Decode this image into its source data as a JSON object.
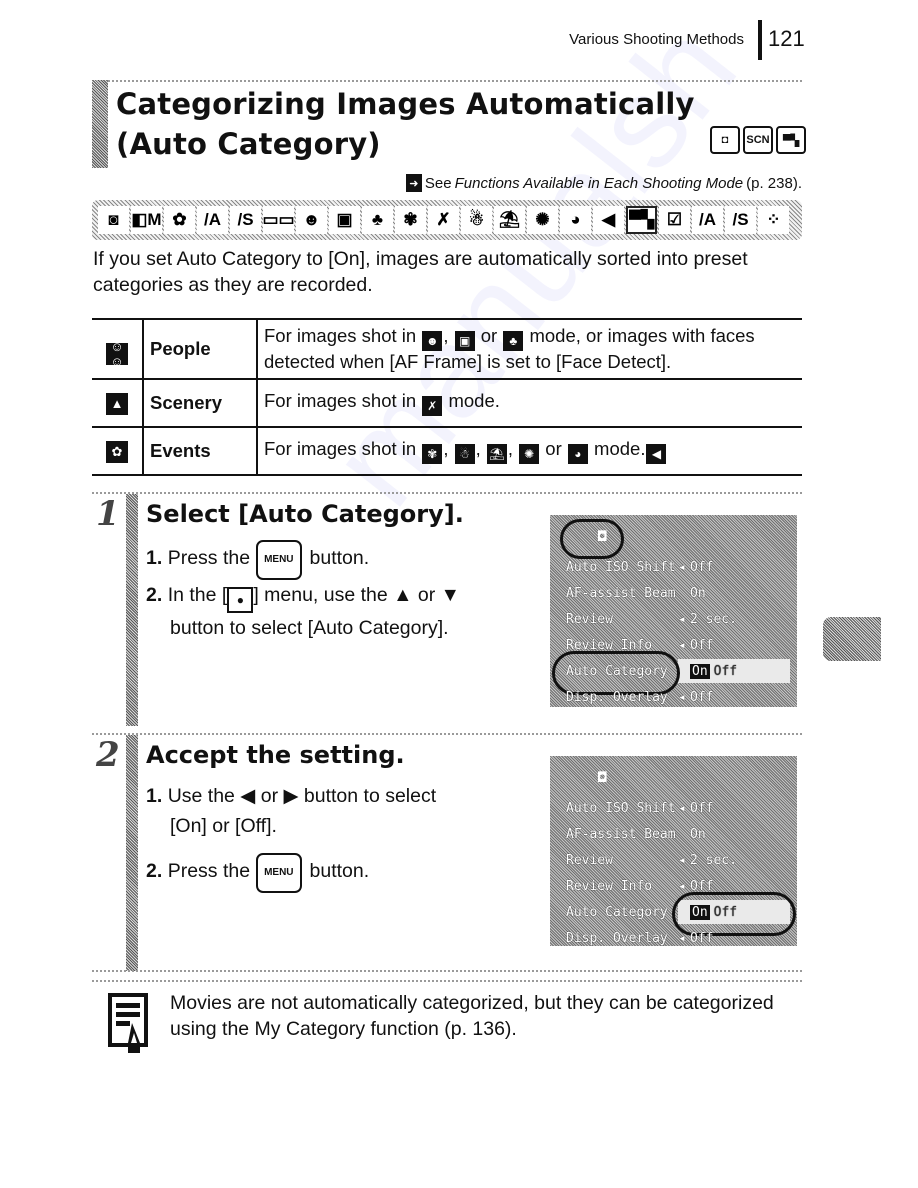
{
  "header": {
    "running_head": "Various Shooting Methods",
    "page_number": "121"
  },
  "title": {
    "line1": "Categorizing Images Automatically",
    "line2": "(Auto Category)",
    "mode_icons": [
      "camera-mode-icon",
      "scn-mode-icon",
      "movie-mode-icon"
    ],
    "mode_labels": [
      "◘",
      "SCN",
      "▀▚"
    ]
  },
  "see_also": {
    "prefix": "See",
    "italic": "Functions Available in Each Shooting Mode",
    "suffix": "(p. 238)."
  },
  "icon_strip": {
    "icons": [
      {
        "name": "auto-mode-icon",
        "glyph": "◙"
      },
      {
        "name": "camera-m-mode-icon",
        "glyph": "◧M"
      },
      {
        "name": "digital-macro-icon",
        "glyph": "✿"
      },
      {
        "name": "av-mode-icon",
        "glyph": "/A"
      },
      {
        "name": "tv-mode-icon",
        "glyph": "/S"
      },
      {
        "name": "stitch-assist-icon",
        "glyph": "▭▭"
      },
      {
        "name": "portrait-icon",
        "glyph": "☻"
      },
      {
        "name": "night-snapshot-icon",
        "glyph": "▣"
      },
      {
        "name": "kids-pets-icon",
        "glyph": "♣"
      },
      {
        "name": "indoor-party-icon",
        "glyph": "✾"
      },
      {
        "name": "foliage-icon",
        "glyph": "✗"
      },
      {
        "name": "snow-icon",
        "glyph": "☃"
      },
      {
        "name": "beach-icon",
        "glyph": "⛱"
      },
      {
        "name": "fireworks-icon",
        "glyph": "✺"
      },
      {
        "name": "aquarium-icon",
        "glyph": "◕"
      },
      {
        "name": "underwater-icon",
        "glyph": "◀"
      },
      {
        "name": "movie-standard-icon",
        "glyph": "▀▚",
        "framed": true
      },
      {
        "name": "movie-my-colors-icon",
        "glyph": "☑"
      },
      {
        "name": "movie-av-icon",
        "glyph": "/A"
      },
      {
        "name": "movie-tv-icon",
        "glyph": "/S"
      },
      {
        "name": "movie-time-lapse-icon",
        "glyph": "⁘"
      }
    ]
  },
  "intro": "If you set Auto Category to [On], images are automatically sorted into preset categories as they are recorded.",
  "table": {
    "rows": [
      {
        "icon": "people-category-icon",
        "glyph": "☺☺",
        "name": "People",
        "desc_parts": [
          "For images shot in",
          ", ",
          " or ",
          " mode, or images with faces detected when [AF Frame] is set to [Face Detect]."
        ],
        "modes": [
          {
            "name": "portrait-mode-icon",
            "glyph": "☻"
          },
          {
            "name": "night-snapshot-mode-icon",
            "glyph": "▣"
          },
          {
            "name": "kids-pets-mode-icon",
            "glyph": "♣"
          }
        ]
      },
      {
        "icon": "scenery-category-icon",
        "glyph": "▲",
        "name": "Scenery",
        "desc_parts": [
          "For images shot in",
          " mode."
        ],
        "modes": [
          {
            "name": "foliage-mode-icon",
            "glyph": "✗"
          }
        ]
      },
      {
        "icon": "events-category-icon",
        "glyph": "✿",
        "name": "Events",
        "desc_parts": [
          "For images shot in",
          ", ",
          ", ",
          ", ",
          " or ",
          " mode."
        ],
        "modes": [
          {
            "name": "indoor-party-mode-icon",
            "glyph": "✾"
          },
          {
            "name": "snow-mode-icon",
            "glyph": "☃"
          },
          {
            "name": "beach-mode-icon",
            "glyph": "⛱"
          },
          {
            "name": "fireworks-mode-icon",
            "glyph": "✺"
          },
          {
            "name": "aquarium-mode-icon",
            "glyph": "◕"
          },
          {
            "name": "underwater-mode-icon",
            "glyph": "◀"
          }
        ]
      }
    ]
  },
  "steps": [
    {
      "number": "1",
      "title": "Select [Auto Category].",
      "lines": [
        {
          "num": "1.",
          "before": "Press the",
          "button": "MENU",
          "after": "button."
        },
        {
          "num": "2.",
          "before": "In the [",
          "cam": "●",
          "after": "] menu, use the ▲ or ▼"
        },
        {
          "cont": "button to select [Auto Category]."
        }
      ],
      "screen": {
        "tab": "◘",
        "rows": [
          {
            "label": "Auto ISO Shift",
            "arrow": "◂",
            "value": "Off"
          },
          {
            "label": "AF-assist Beam",
            "arrow": "",
            "value": "On"
          },
          {
            "label": "Review",
            "arrow": "◂",
            "value": "2 sec."
          },
          {
            "label": "Review Info",
            "arrow": "◂",
            "value": "Off"
          },
          {
            "label": "Auto Category",
            "arrow": "",
            "value_on": "On",
            "value": "Off",
            "selected": true
          },
          {
            "label": "Disp. Overlay",
            "arrow": "◂",
            "value": "Off"
          }
        ]
      }
    },
    {
      "number": "2",
      "title": "Accept the setting.",
      "lines": [
        {
          "num": "1.",
          "before": "Use the ◀ or ▶ button to select",
          "after": ""
        },
        {
          "cont": "[On] or [Off]."
        },
        {
          "num": "2.",
          "before": "Press the",
          "button": "MENU",
          "after": "button."
        }
      ],
      "screen": {
        "tab": "◘",
        "rows": [
          {
            "label": "Auto ISO Shift",
            "arrow": "◂",
            "value": "Off"
          },
          {
            "label": "AF-assist Beam",
            "arrow": "",
            "value": "On"
          },
          {
            "label": "Review",
            "arrow": "◂",
            "value": "2 sec."
          },
          {
            "label": "Review Info",
            "arrow": "◂",
            "value": "Off"
          },
          {
            "label": "Auto Category",
            "arrow": "",
            "value_on": "On",
            "value": "Off",
            "selected": true
          },
          {
            "label": "Disp. Overlay",
            "arrow": "◂",
            "value": "Off"
          }
        ]
      }
    }
  ],
  "note": {
    "text": "Movies are not automatically categorized, but they can be categorized using the My Category function (p. 136)."
  },
  "watermark": "manualsh"
}
